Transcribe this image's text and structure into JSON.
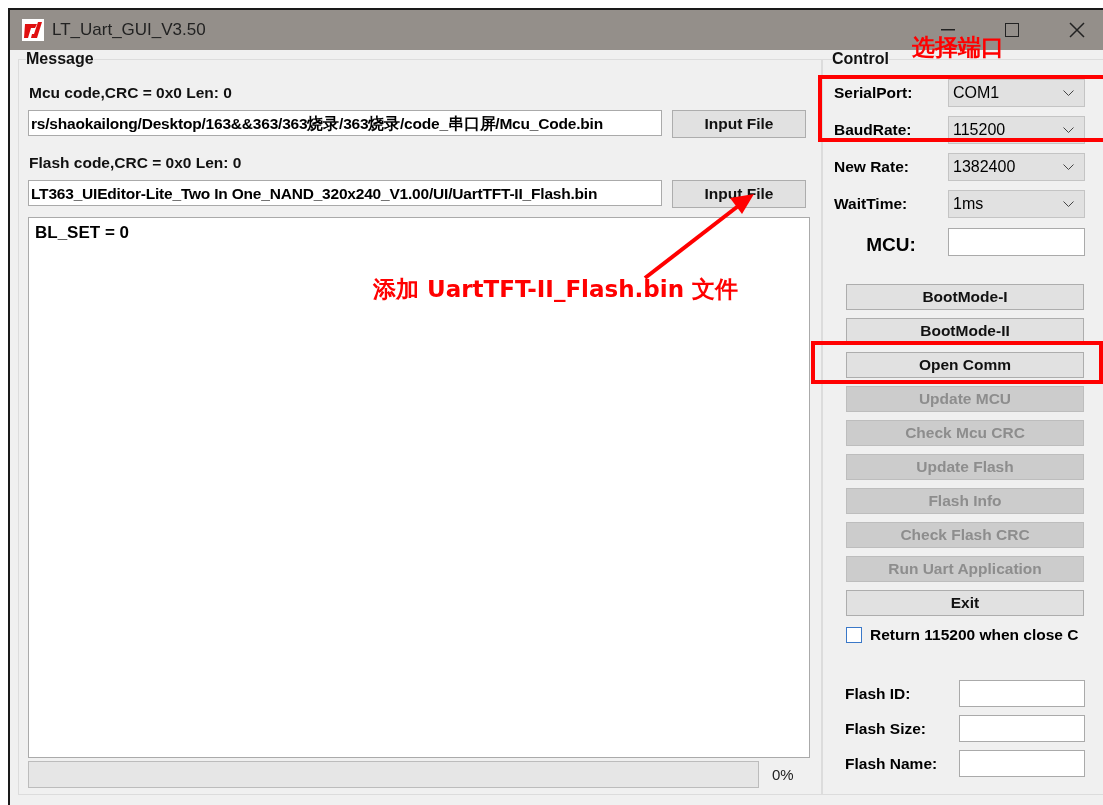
{
  "window": {
    "title": "LT_Uart_GUI_V3.50"
  },
  "message": {
    "title": "Message",
    "mcu_label": "Mcu code,CRC = 0x0  Len: 0",
    "mcu_path": "rs/shaokailong/Desktop/163&&363/363烧录/363烧录/code_串口屏/Mcu_Code.bin",
    "mcu_button": "Input File",
    "flash_label": "Flash code,CRC = 0x0  Len: 0",
    "flash_path": "LT363_UIEditor-Lite_Two In One_NAND_320x240_V1.00/UI/UartTFT-II_Flash.bin",
    "flash_button": "Input File",
    "log": "BL_SET = 0",
    "progress": {
      "level": 0,
      "reading": "0%"
    }
  },
  "control": {
    "title": "Control",
    "selects": [
      {
        "label": "SerialPort:",
        "value": "COM1"
      },
      {
        "label": "BaudRate:",
        "value": "115200"
      },
      {
        "label": "New Rate:",
        "value": "1382400"
      },
      {
        "label": "WaitTime:",
        "value": "1ms"
      }
    ],
    "mcu_label": "MCU:",
    "buttons": [
      {
        "label": "BootMode-I",
        "disabled": false
      },
      {
        "label": "BootMode-II",
        "disabled": false
      },
      {
        "label": "Open Comm",
        "disabled": false
      },
      {
        "label": "Update MCU",
        "disabled": true
      },
      {
        "label": "Check Mcu CRC",
        "disabled": true
      },
      {
        "label": "Update Flash",
        "disabled": true
      },
      {
        "label": "Flash Info",
        "disabled": true
      },
      {
        "label": "Check Flash CRC",
        "disabled": true
      },
      {
        "label": "Run Uart Application",
        "disabled": true
      },
      {
        "label": "Exit",
        "disabled": false
      }
    ],
    "checkbox": {
      "label": "Return 115200 when close C",
      "checked": false
    },
    "info_fields": [
      {
        "label": "Flash ID:"
      },
      {
        "label": "Flash Size:"
      },
      {
        "label": "Flash Name:"
      }
    ]
  },
  "annotations": [
    {
      "kind": "port-note",
      "text": "选择端口"
    },
    {
      "kind": "file-note",
      "text": "添加 UartTFT-II_Flash.bin 文件"
    }
  ]
}
